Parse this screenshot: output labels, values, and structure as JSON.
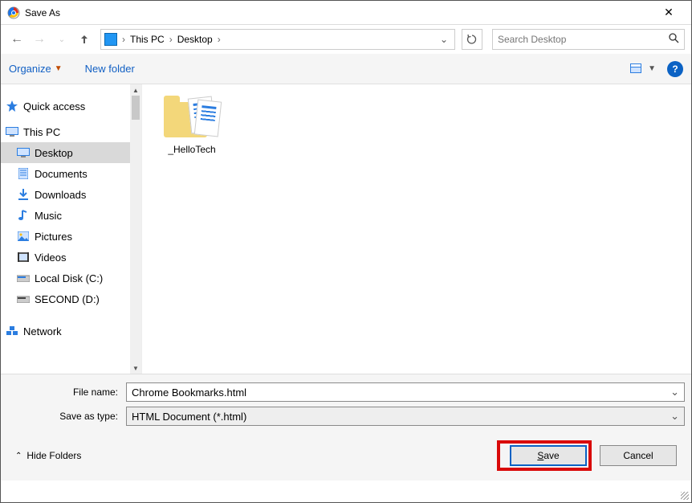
{
  "titlebar": {
    "title": "Save As"
  },
  "nav": {
    "breadcrumbs": [
      "This PC",
      "Desktop"
    ],
    "search_placeholder": "Search Desktop"
  },
  "toolbar": {
    "organize": "Organize",
    "new_folder": "New folder",
    "view_icon": "view-dropdown",
    "help": "?"
  },
  "sidebar": {
    "quick_access": "Quick access",
    "this_pc": "This PC",
    "items": [
      {
        "label": "Desktop",
        "icon": "monitor-icon",
        "selected": true
      },
      {
        "label": "Documents",
        "icon": "document-icon"
      },
      {
        "label": "Downloads",
        "icon": "download-icon"
      },
      {
        "label": "Music",
        "icon": "music-icon"
      },
      {
        "label": "Pictures",
        "icon": "picture-icon"
      },
      {
        "label": "Videos",
        "icon": "video-icon"
      },
      {
        "label": "Local Disk (C:)",
        "icon": "drive-icon"
      },
      {
        "label": "SECOND (D:)",
        "icon": "drive-icon"
      }
    ],
    "network": "Network"
  },
  "content": {
    "folders": [
      {
        "name": "_HelloTech"
      }
    ]
  },
  "footer": {
    "filename_label": "File name:",
    "filename_value": "Chrome Bookmarks.html",
    "type_label": "Save as type:",
    "type_value": "HTML Document (*.html)",
    "hide_folders": "Hide Folders",
    "save": "Save",
    "cancel": "Cancel"
  }
}
